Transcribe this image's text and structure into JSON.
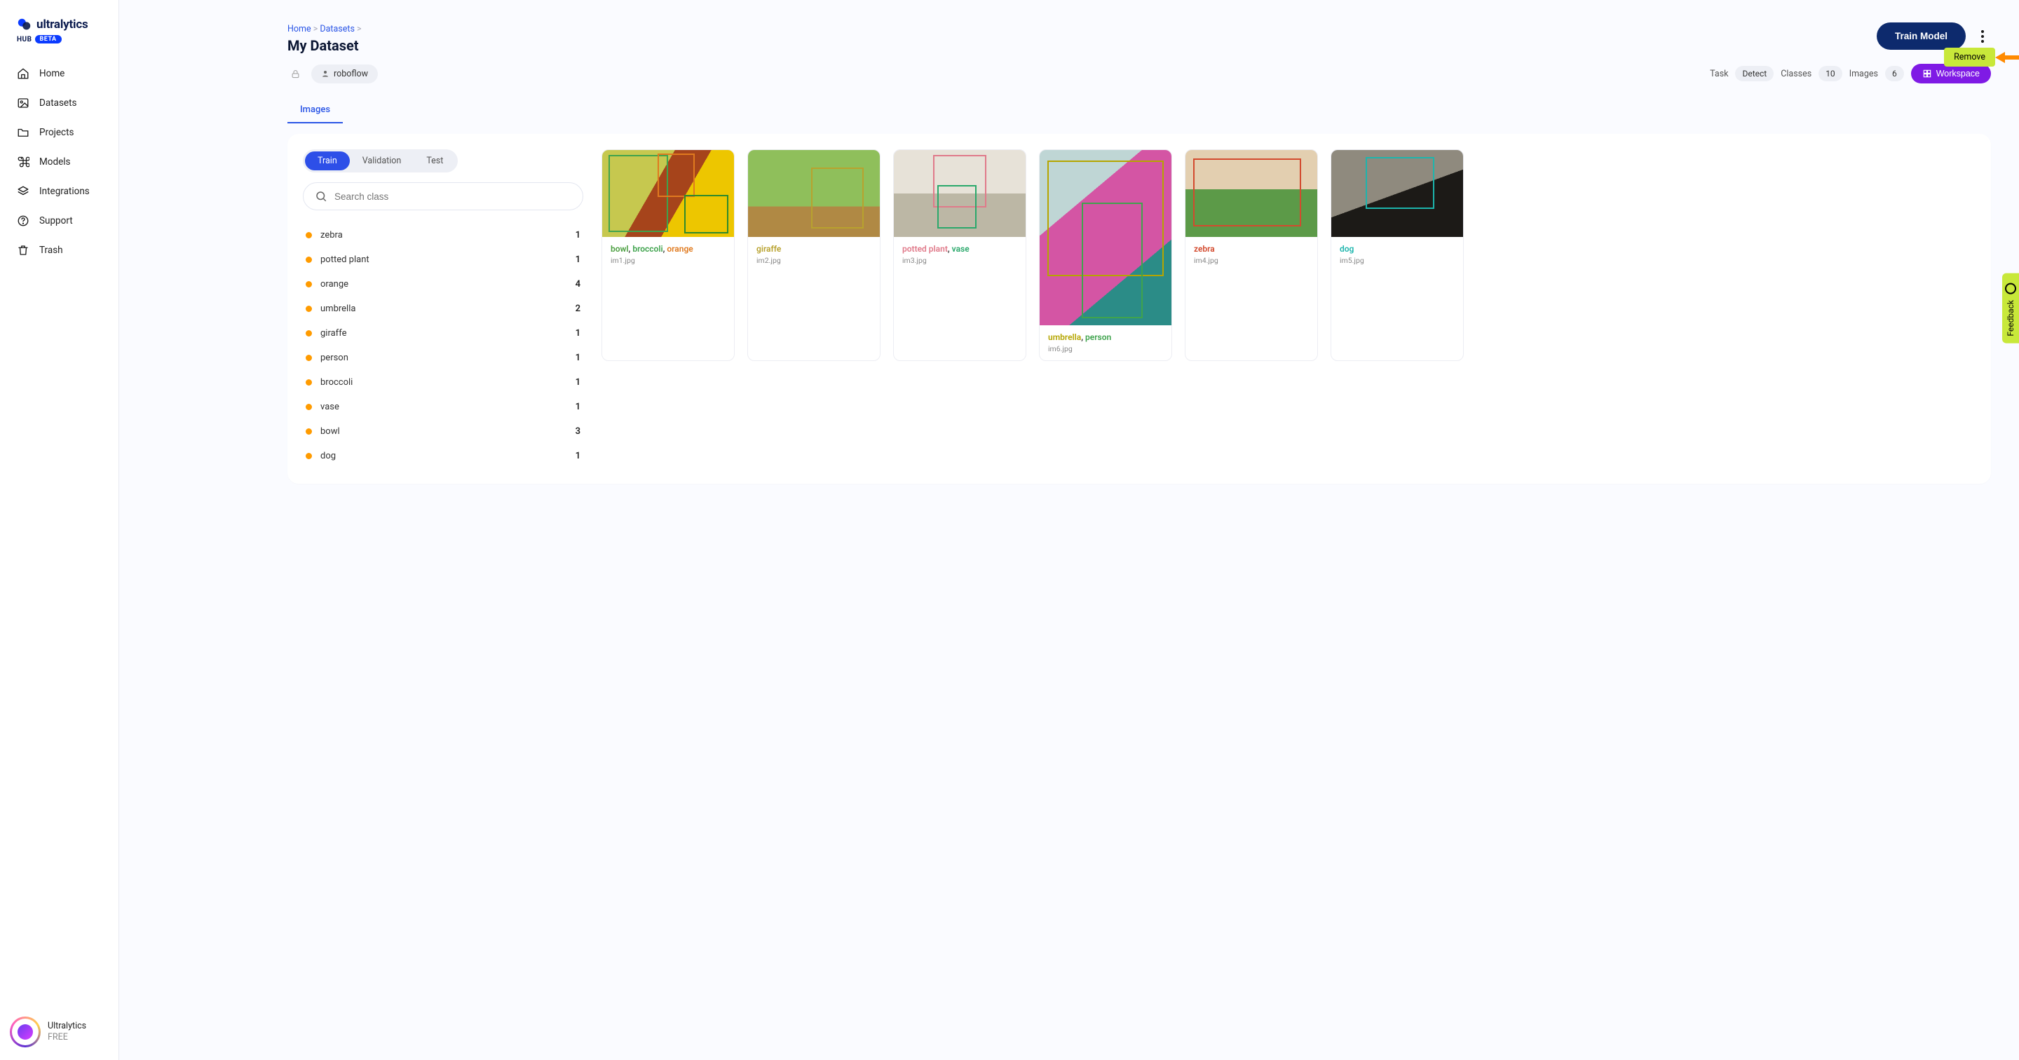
{
  "brand": {
    "name": "ultralytics",
    "sub": "HUB",
    "badge": "BETA"
  },
  "sidebar": {
    "items": [
      {
        "label": "Home"
      },
      {
        "label": "Datasets"
      },
      {
        "label": "Projects"
      },
      {
        "label": "Models"
      },
      {
        "label": "Integrations"
      },
      {
        "label": "Support"
      },
      {
        "label": "Trash"
      }
    ],
    "footer": {
      "name": "Ultralytics",
      "plan": "FREE"
    }
  },
  "breadcrumbs": {
    "root": "Home",
    "section": "Datasets"
  },
  "page": {
    "title": "My Dataset",
    "train_btn": "Train Model",
    "remove_label": "Remove",
    "owner": "roboflow",
    "task_label": "Task",
    "task_value": "Detect",
    "classes_label": "Classes",
    "classes_value": "10",
    "images_label": "Images",
    "images_value": "6",
    "workspace_btn": "Workspace",
    "tab_images": "Images"
  },
  "splits": {
    "train": "Train",
    "val": "Validation",
    "test": "Test"
  },
  "search": {
    "placeholder": "Search class"
  },
  "classes": [
    {
      "name": "zebra",
      "count": "1"
    },
    {
      "name": "potted plant",
      "count": "1"
    },
    {
      "name": "orange",
      "count": "4"
    },
    {
      "name": "umbrella",
      "count": "2"
    },
    {
      "name": "giraffe",
      "count": "1"
    },
    {
      "name": "person",
      "count": "1"
    },
    {
      "name": "broccoli",
      "count": "1"
    },
    {
      "name": "vase",
      "count": "1"
    },
    {
      "name": "bowl",
      "count": "3"
    },
    {
      "name": "dog",
      "count": "1"
    }
  ],
  "images": [
    {
      "file": "im1.jpg",
      "labels": [
        {
          "t": "bowl",
          "c": "bowl"
        },
        {
          "t": "broccoli",
          "c": "broccoli"
        },
        {
          "t": "orange",
          "c": "orange"
        }
      ]
    },
    {
      "file": "im2.jpg",
      "labels": [
        {
          "t": "giraffe",
          "c": "giraffe"
        }
      ]
    },
    {
      "file": "im3.jpg",
      "labels": [
        {
          "t": "potted plant",
          "c": "potted"
        },
        {
          "t": "vase",
          "c": "vase"
        }
      ]
    },
    {
      "file": "im4.jpg",
      "labels": [
        {
          "t": "zebra",
          "c": "zebra"
        }
      ]
    },
    {
      "file": "im5.jpg",
      "labels": [
        {
          "t": "dog",
          "c": "dog"
        }
      ]
    },
    {
      "file": "im6.jpg",
      "labels": [
        {
          "t": "umbrella",
          "c": "umbrella"
        },
        {
          "t": "person",
          "c": "person"
        }
      ]
    }
  ],
  "feedback": {
    "label": "Feedback"
  }
}
